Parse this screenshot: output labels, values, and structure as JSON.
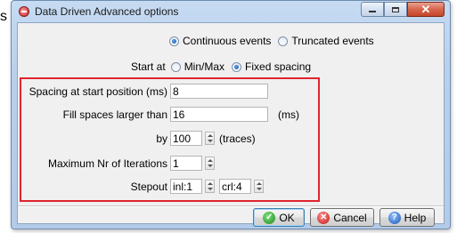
{
  "outside_text": "s",
  "window": {
    "title": "Data Driven Advanced options",
    "controls": {
      "minimize": "—",
      "maximize": "",
      "close": "✕"
    }
  },
  "events": {
    "options": [
      "Continuous events",
      "Truncated events"
    ],
    "selected": "Continuous events"
  },
  "start_at": {
    "label": "Start at",
    "options": [
      "Min/Max",
      "Fixed spacing"
    ],
    "selected": "Fixed spacing"
  },
  "params": {
    "spacing_label": "Spacing at start position (ms)",
    "spacing_value": "8",
    "fill_label": "Fill spaces larger than",
    "fill_value": "16",
    "fill_unit": "(ms)",
    "by_label": "by",
    "by_value": "100",
    "by_unit": "(traces)",
    "max_iter_label": "Maximum Nr of Iterations",
    "max_iter_value": "1",
    "stepout_label": "Stepout",
    "stepout_inl": "inl:1",
    "stepout_crl": "crl:4"
  },
  "buttons": {
    "ok": "OK",
    "cancel": "Cancel",
    "help": "Help"
  },
  "icons": {
    "app": "app-icon",
    "ok": "check-icon",
    "cancel": "x-icon",
    "help": "question-icon"
  },
  "colors": {
    "highlight_box": "#e0242f",
    "title_bar": "#c6dbf2",
    "client_bg": "#f0f0f0"
  }
}
